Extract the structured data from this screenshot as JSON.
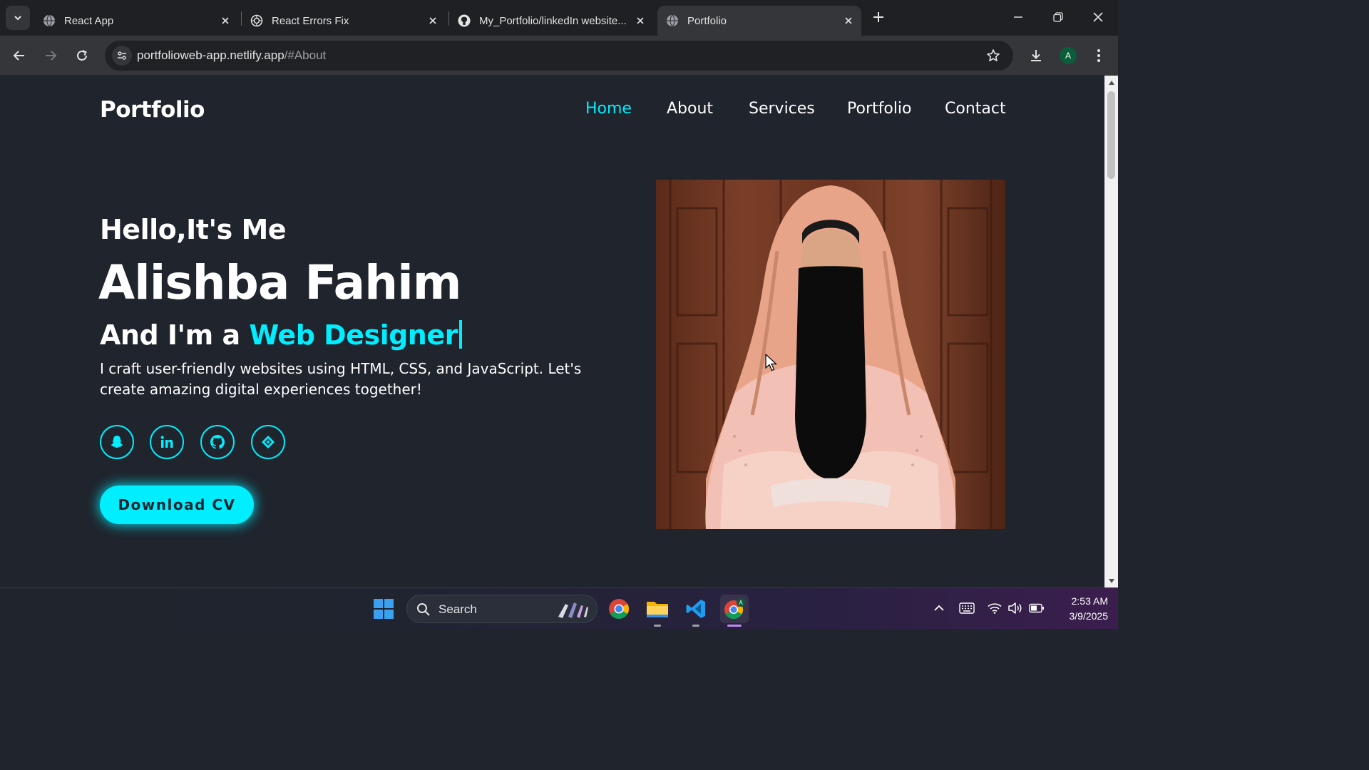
{
  "browser": {
    "tabs": [
      {
        "label": "React App",
        "active": false,
        "favicon": "globe-icon"
      },
      {
        "label": "React Errors Fix",
        "active": false,
        "favicon": "openai-icon"
      },
      {
        "label": "My_Portfolio/linkedIn website...",
        "active": false,
        "favicon": "github-icon"
      },
      {
        "label": "Portfolio",
        "active": true,
        "favicon": "globe-icon"
      }
    ],
    "url_host": "portfolioweb-app.netlify.app",
    "url_path": "/#About",
    "profile_initial": "A"
  },
  "site": {
    "logo": "Portfolio",
    "nav": [
      {
        "label": "Home",
        "active": true
      },
      {
        "label": "About",
        "active": false
      },
      {
        "label": "Services",
        "active": false
      },
      {
        "label": "Portfolio",
        "active": false
      },
      {
        "label": "Contact",
        "active": false
      }
    ],
    "hero": {
      "greeting": "Hello,It's Me",
      "name": "Alishba Fahim",
      "role_prefix": "And I'm a ",
      "role_accent": "Web Designer",
      "description": "I craft user-friendly websites using HTML, CSS, and JavaScript. Let's create amazing digital experiences together!",
      "cta": "Download CV"
    },
    "social_icons": [
      "snapchat-icon",
      "linkedin-icon",
      "github-icon",
      "diamond-icon"
    ],
    "accent_color": "#00eeff",
    "background_color": "#1f242d"
  },
  "taskbar": {
    "search_label": "Search",
    "time": "2:53 AM",
    "date": "3/9/2025"
  }
}
